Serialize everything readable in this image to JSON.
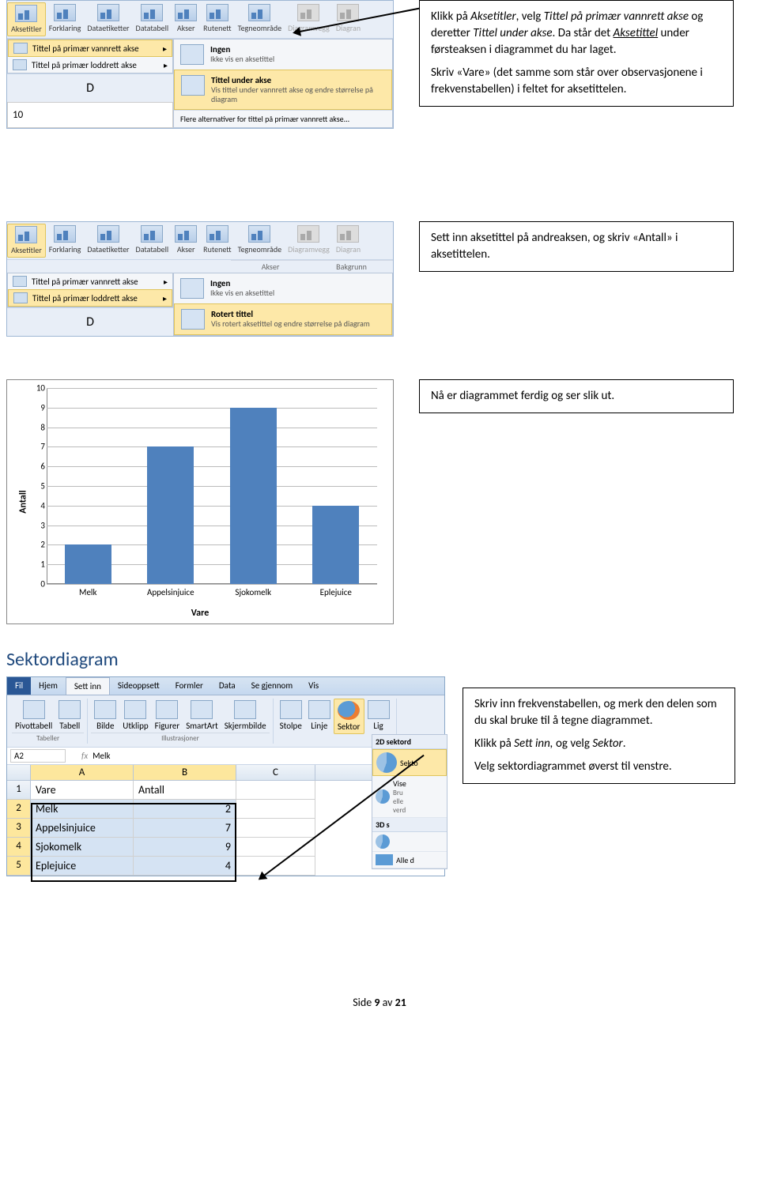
{
  "section1": {
    "ribbon": {
      "buttons": [
        "Aksetitler",
        "Forklaring",
        "Dataetiketter",
        "Datatabell",
        "Akser",
        "Rutenett",
        "Tegneområde",
        "Diagramvegg",
        "Diagran"
      ],
      "activeIndex": 0
    },
    "menu": {
      "row1": "Tittel på primær vannrett akse",
      "row2": "Tittel på primær loddrett akse"
    },
    "submenu": {
      "item1_title": "Ingen",
      "item1_desc": "Ikke vis en aksetittel",
      "item2_title": "Tittel under akse",
      "item2_desc": "Vis tittel under vannrett akse og endre størrelse på diagram",
      "footer": "Flere alternativer for tittel på primær vannrett akse..."
    },
    "colD": "D",
    "rowNum": "10",
    "callout": {
      "p1_a": "Klikk på ",
      "p1_b": "Aksetitler",
      "p1_c": ", velg ",
      "p1_d": "Tittel på primær vannrett akse",
      "p1_e": " og deretter ",
      "p1_f": "Tittel under akse",
      "p1_g": ". Da står det ",
      "p1_h": "Aksetittel",
      "p1_i": " under førsteaksen i diagrammet du har laget.",
      "p2": "Skriv «Vare» (det samme som står over observasjonene i frekvenstabellen) i feltet for aksetittelen."
    }
  },
  "section2": {
    "ribbon": {
      "buttons": [
        "Aksetitler",
        "Forklaring",
        "Dataetiketter",
        "Datatabell",
        "Akser",
        "Rutenett",
        "Tegneområde",
        "Diagramvegg",
        "Diagran"
      ],
      "group1": "Akser",
      "group2": "Bakgrunn"
    },
    "menu": {
      "row1": "Tittel på primær vannrett akse",
      "row2": "Tittel på primær loddrett akse"
    },
    "submenu": {
      "item1_title": "Ingen",
      "item1_desc": "Ikke vis en aksetittel",
      "item2_title": "Rotert tittel",
      "item2_desc": "Vis rotert aksetittel og endre størrelse på diagram"
    },
    "colD": "D",
    "callout": "Sett inn aksetittel på andreaksen, og skriv «Antall» i aksetittelen."
  },
  "section3": {
    "callout": "Nå er diagrammet ferdig og ser slik ut."
  },
  "chart_data": {
    "type": "bar",
    "categories": [
      "Melk",
      "Appelsinjuice",
      "Sjokomelk",
      "Eplejuice"
    ],
    "values": [
      2,
      7,
      9,
      4
    ],
    "title": "",
    "xlabel": "Vare",
    "ylabel": "Antall",
    "ylim": [
      0,
      10
    ],
    "yticks": [
      0,
      1,
      2,
      3,
      4,
      5,
      6,
      7,
      8,
      9,
      10
    ]
  },
  "section4": {
    "heading": "Sektordiagram",
    "tabs": [
      "Fil",
      "Hjem",
      "Sett inn",
      "Sideoppsett",
      "Formler",
      "Data",
      "Se gjennom",
      "Vis"
    ],
    "activeTab": 2,
    "groups": {
      "tabeller": {
        "label": "Tabeller",
        "items": [
          "Pivottabell",
          "Tabell"
        ]
      },
      "illustrasjoner": {
        "label": "Illustrasjoner",
        "items": [
          "Bilde",
          "Utklipp",
          "Figurer",
          "SmartArt",
          "Skjermbilde"
        ]
      },
      "diagrammer": {
        "items": [
          "Stolpe",
          "Linje",
          "Sektor",
          "Lig"
        ]
      }
    },
    "nameBox": "A2",
    "fxValue": "Melk",
    "columns": [
      "A",
      "B",
      "C"
    ],
    "table": {
      "headers": [
        "Vare",
        "Antall"
      ],
      "rows": [
        {
          "n": "1",
          "a": "Vare",
          "b": "Antall"
        },
        {
          "n": "2",
          "a": "Melk",
          "b": "2"
        },
        {
          "n": "3",
          "a": "Appelsinjuice",
          "b": "7"
        },
        {
          "n": "4",
          "a": "Sjokomelk",
          "b": "9"
        },
        {
          "n": "5",
          "a": "Eplejuice",
          "b": "4"
        }
      ]
    },
    "dropdown": {
      "title": "2D sektord",
      "item1": "Sekto",
      "item2": "Vise",
      "item3a": "Bru",
      "item3b": "elle",
      "item3c": "verd",
      "sep": "3D s",
      "footer": "Alle d"
    },
    "callout": {
      "p1": "Skriv inn frekvenstabellen, og merk den delen som du skal bruke til å tegne diagrammet.",
      "p2_a": "Klikk på ",
      "p2_b": "Sett inn,",
      "p2_c": " og velg ",
      "p2_d": "Sektor",
      "p2_e": ".",
      "p3": "Velg sektordiagrammet øverst til venstre."
    }
  },
  "footer": {
    "a": "Side ",
    "b": "9",
    "c": " av ",
    "d": "21"
  }
}
